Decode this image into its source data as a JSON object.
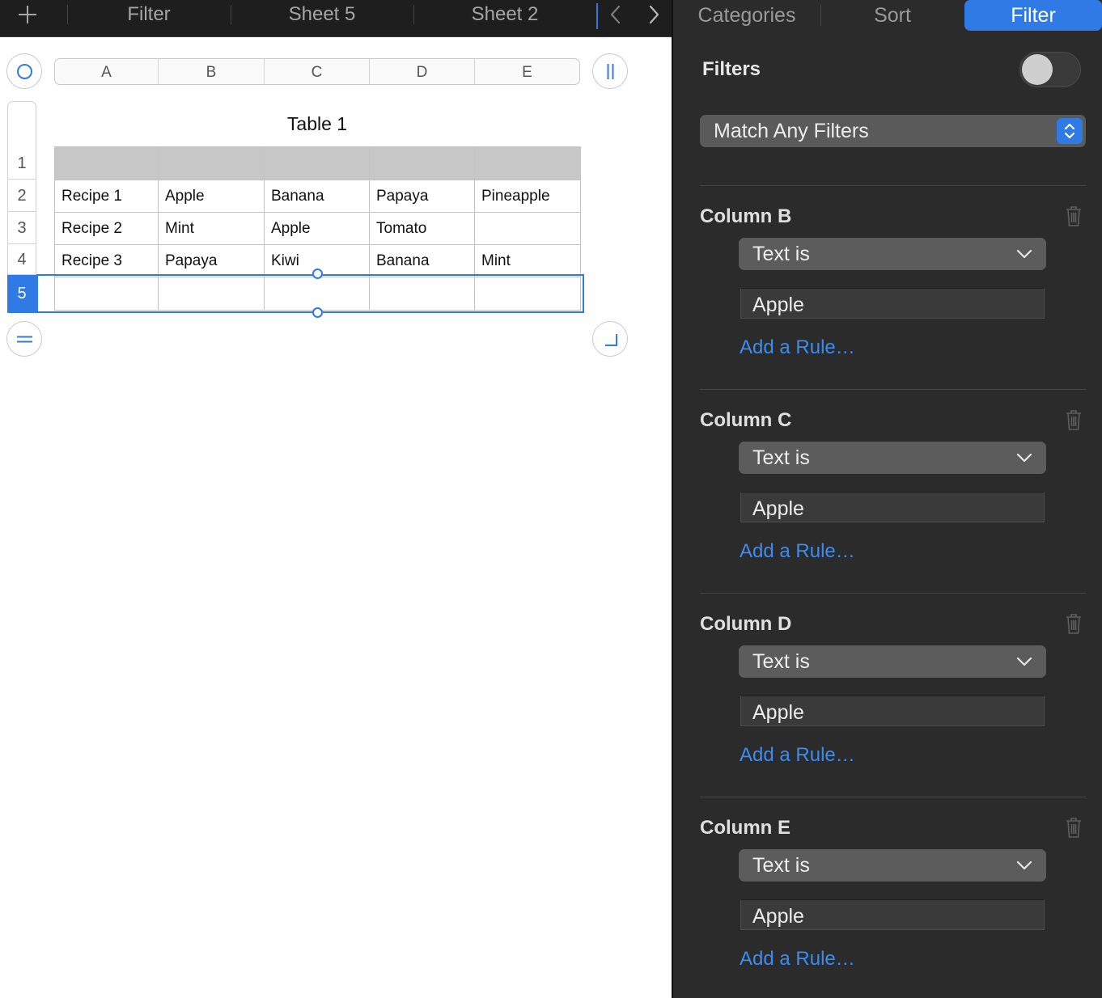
{
  "tabbar": {
    "tabs": [
      "Filter",
      "Sheet 5",
      "Sheet 2"
    ]
  },
  "sheet": {
    "columns": [
      "A",
      "B",
      "C",
      "D",
      "E"
    ],
    "rows": [
      "1",
      "2",
      "3",
      "4",
      "5"
    ],
    "selected_row": "5",
    "table_title": "Table 1",
    "cells": [
      [
        "",
        "",
        "",
        "",
        ""
      ],
      [
        "Recipe 1",
        "Apple",
        "Banana",
        "Papaya",
        "Pineapple"
      ],
      [
        "Recipe 2",
        "Mint",
        "Apple",
        "Tomato",
        ""
      ],
      [
        "Recipe 3",
        "Papaya",
        "Kiwi",
        "Banana",
        "Mint"
      ],
      [
        "",
        "",
        "",
        "",
        ""
      ]
    ]
  },
  "inspector": {
    "tabs": [
      "Categories",
      "Sort",
      "Filter"
    ],
    "active_tab": "Filter",
    "filters_label": "Filters",
    "filters_enabled": false,
    "match_mode": "Match Any Filters",
    "rules": [
      {
        "column": "Column B",
        "condition": "Text is",
        "value": "Apple",
        "add_rule": "Add a Rule…"
      },
      {
        "column": "Column C",
        "condition": "Text is",
        "value": "Apple",
        "add_rule": "Add a Rule…"
      },
      {
        "column": "Column D",
        "condition": "Text is",
        "value": "Apple",
        "add_rule": "Add a Rule…"
      },
      {
        "column": "Column E",
        "condition": "Text is",
        "value": "Apple",
        "add_rule": "Add a Rule…"
      }
    ]
  },
  "colors": {
    "accent": "#2f7ae5",
    "panel_bg": "#2b2b2b",
    "header_row_fill": "#c6c7c6",
    "link": "#3d8cf0"
  }
}
